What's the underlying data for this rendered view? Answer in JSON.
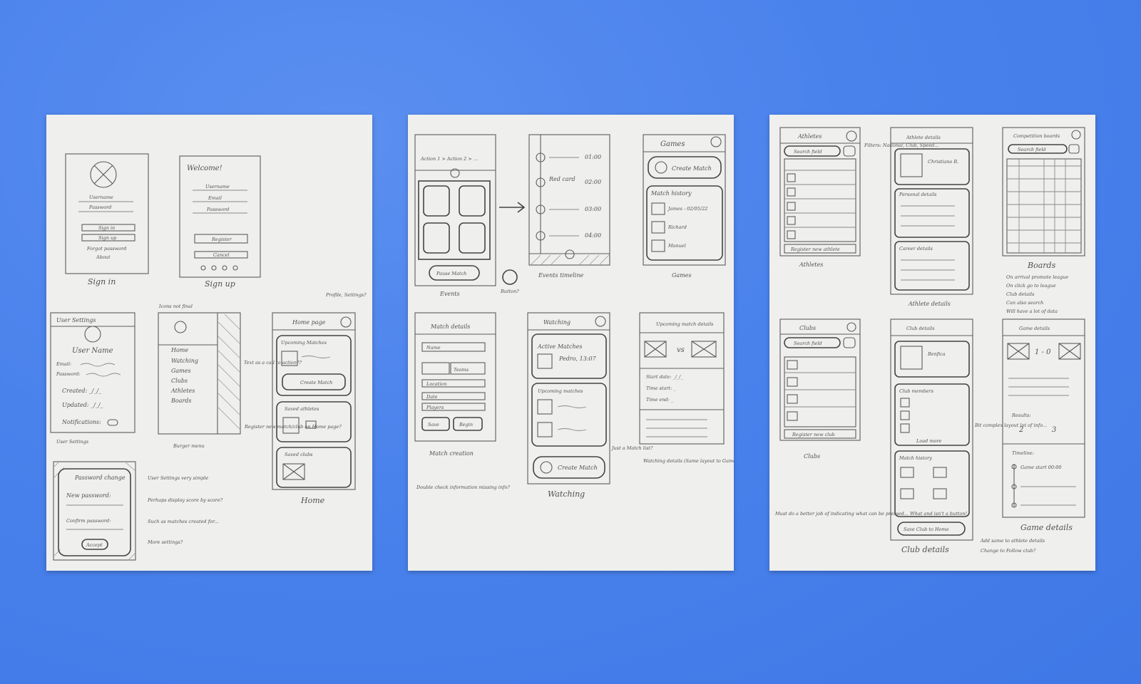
{
  "sheet1": {
    "sign_in": {
      "caption": "Sign in",
      "username": "Username",
      "password": "Password",
      "signin": "Sign in",
      "signup": "Sign up",
      "forgot": "Forgot password",
      "about": "About"
    },
    "sign_up": {
      "caption": "Sign up",
      "title": "Welcome!",
      "username": "Username",
      "email": "Email",
      "password": "Password",
      "register": "Register",
      "cancel": "Cancel"
    },
    "user_settings": {
      "caption": "User Settings",
      "title": "User Settings",
      "user_name": "User Name",
      "email": "Email:",
      "password": "Password:",
      "created": "Created: _/_/_",
      "updated": "Updated: _/_/_",
      "notif": "Notifications:"
    },
    "burger": {
      "caption": "Burger menu",
      "note_top": "Icons not final",
      "items": [
        "Home",
        "Watching",
        "Games",
        "Clubs",
        "Athletes",
        "Boards"
      ]
    },
    "home": {
      "caption": "Home",
      "title": "Home page",
      "upcoming": "Upcoming Matches",
      "create": "Create Match",
      "saved_athletes": "Saved athletes",
      "saved_clubs": "Saved clubs",
      "note_profile": "Profile, Settings?",
      "note_text": "Text as a call to action??",
      "note_register": "Register new match/club on Home page?"
    },
    "password_change": {
      "title": "Password change",
      "new_pw": "New password:",
      "confirm_pw": "Confirm password:",
      "accept": "Accept"
    },
    "notes": [
      "User Settings very simple",
      "Perhaps display score by score?",
      "Such as matches created for...",
      "More settings?"
    ]
  },
  "sheet2": {
    "events": {
      "caption": "Events",
      "header": "Action 1 > Action 2 > ...",
      "pause": "Pause Match",
      "button_note": "Button?"
    },
    "timeline": {
      "caption": "Events timeline",
      "times": [
        "01:00",
        "02:00",
        "03:00",
        "04:00"
      ],
      "red_card": "Red card"
    },
    "games": {
      "caption": "Games",
      "title": "Games",
      "create": "Create Match",
      "history": "Match history",
      "rows": [
        "James - 02/05/22",
        "Richard",
        "Manuel"
      ]
    },
    "match_creation": {
      "caption": "Match creation",
      "title": "Match details",
      "fields": [
        "Name",
        "Teams",
        "Location",
        "Date",
        "Players"
      ],
      "save": "Save",
      "begin": "Begin"
    },
    "watching": {
      "caption": "Watching",
      "title": "Watching",
      "active": "Active Matches",
      "active_row": "Pedro, 13:07",
      "upcoming": "Upcoming matches",
      "create": "Create Match",
      "note": "Just a Match list?"
    },
    "watching_details": {
      "caption": "Watching details (Same layout to Games' detail?)",
      "title": "Upcoming match details",
      "start_date": "Start date: _/_/_",
      "time_start": "Time start: _",
      "time_end": "Time end: _",
      "vs": "vs"
    },
    "notes": [
      "Double check information missing info?"
    ]
  },
  "sheet3": {
    "athletes": {
      "caption": "Athletes",
      "title": "Athletes",
      "search": "Search field",
      "register": "Register new athlete",
      "notes_left": "Filters: National, Club, Speed..."
    },
    "athlete_details": {
      "caption": "Athlete details",
      "title": "Athlete details",
      "name": "Christiano R.",
      "personal": "Personal details",
      "career": "Career details"
    },
    "boards": {
      "caption": "Boards",
      "title": "Competition boards",
      "search": "Search field",
      "notes": [
        "On arrival promote league",
        "On click go to league",
        "Club details",
        "Can also search",
        "Will have a lot of data"
      ]
    },
    "clubs": {
      "caption": "Clubs",
      "title": "Clubs",
      "search": "Search field",
      "register": "Register new club"
    },
    "club_details": {
      "caption": "Club details",
      "title": "Club details",
      "name": "Benfica",
      "members": "Club members",
      "load_more": "Load more",
      "history": "Match history",
      "save_btn": "Save Club to Home"
    },
    "game_details": {
      "caption": "Game details",
      "title": "Game details",
      "score": "1 - 0",
      "results": "Results:",
      "result_left": "2",
      "result_right": "3",
      "timeline": "Timeline:",
      "timeline_item": "Game start 00:00"
    },
    "notes": [
      "Must do a better job of indicating what can be pressed... What and isn't a button!",
      "Add same to athlete details",
      "Change to Follow club?",
      "Bit complex layout lot of info..."
    ]
  }
}
